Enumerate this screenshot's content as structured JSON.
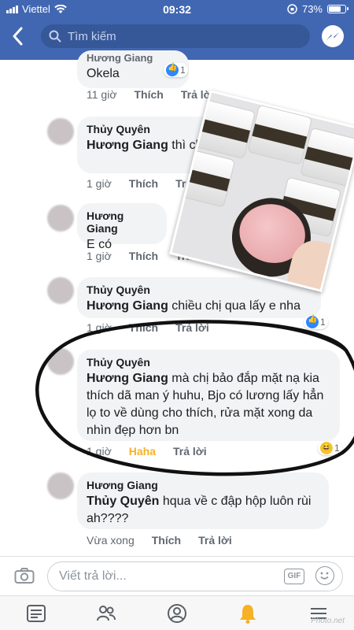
{
  "status": {
    "carrier": "Viettel",
    "time": "09:32",
    "battery": "73%",
    "battery_level": 0.73
  },
  "search": {
    "placeholder": "Tìm kiếm"
  },
  "comments": [
    {
      "author": "Hương Giang",
      "text": "Okela",
      "time": "11 giờ",
      "like": "Thích",
      "reply": "Trả lời",
      "reaction_count": "1"
    },
    {
      "author": "Thủy Quyên",
      "mention": "Hương Giang",
      "text": " thì chị lấy thêm 1 tu",
      "time": "1 giờ",
      "like": "Thích",
      "reply": "Trả lời"
    },
    {
      "author": "Hương Giang",
      "text": "E có",
      "time": "1 giờ",
      "like": "Thích",
      "reply": "Trả lời"
    },
    {
      "author": "Thủy Quyên",
      "mention": "Hương Giang",
      "text": " chiều chị qua lấy e nha",
      "time": "1 giờ",
      "like": "Thích",
      "reply": "Trả lời",
      "reaction_count": "1"
    },
    {
      "author": "Thủy Quyên",
      "mention": "Hương Giang",
      "text": " mà chị bảo đắp mặt nạ kia thích dã man ý huhu, Bjo có lương lấy hẳn lọ to về dùng cho thích, rửa mặt xong da nhìn đẹp hơn bn",
      "time": "1 giờ",
      "like": "Haha",
      "reply": "Trả lời",
      "reaction_count": "1"
    },
    {
      "author": "Hương Giang",
      "mention": "Thủy Quyên",
      "text": " hqua về c đập hộp luôn rùi ah????",
      "time": "Vừa xong",
      "like": "Thích",
      "reply": "Trả lời"
    }
  ],
  "reply_bar": {
    "placeholder": "Viết trả lời...",
    "gif": "GIF"
  },
  "watermark": "Photo.net"
}
